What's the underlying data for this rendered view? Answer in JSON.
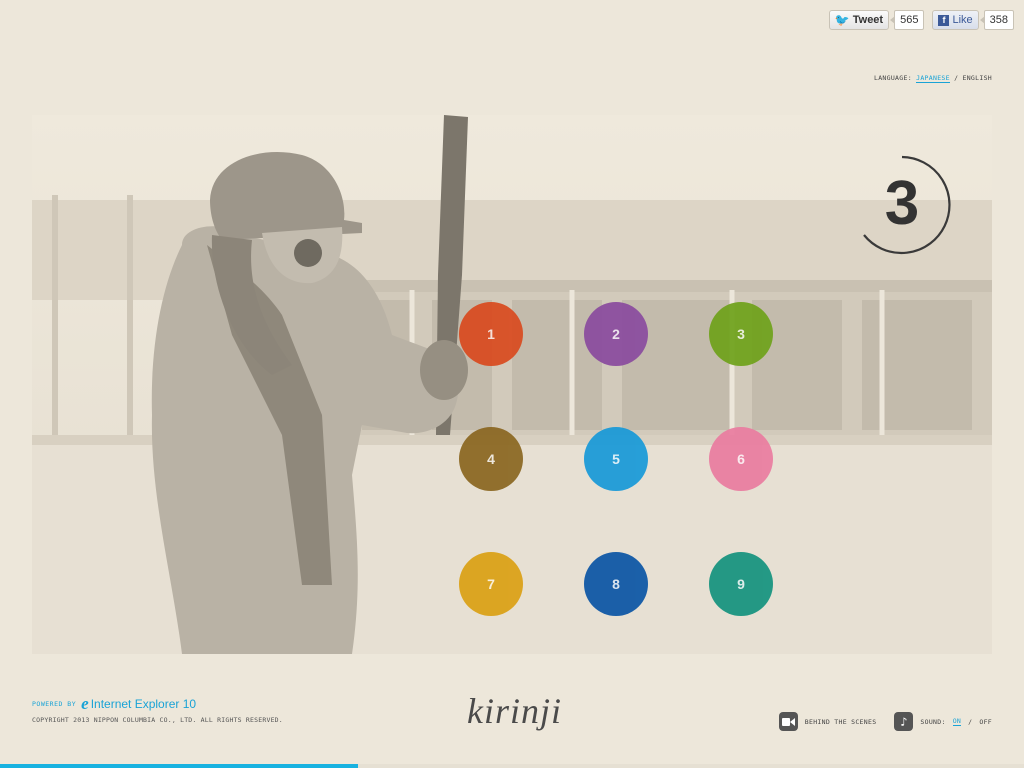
{
  "social": {
    "tweet_label": "Tweet",
    "tweet_count": "565",
    "like_label": "Like",
    "like_count": "358"
  },
  "language": {
    "label": "LANGUAGE:",
    "japanese": "JAPANESE",
    "separator": "/",
    "english": "ENGLISH",
    "active": "JAPANESE"
  },
  "counter": {
    "value": "3"
  },
  "dots": [
    {
      "label": "1",
      "color": "#d94a1e"
    },
    {
      "label": "2",
      "color": "#8a4b9e"
    },
    {
      "label": "3",
      "color": "#6fa21a"
    },
    {
      "label": "4",
      "color": "#8a6620"
    },
    {
      "label": "5",
      "color": "#1799d8"
    },
    {
      "label": "6",
      "color": "#ea7ca0"
    },
    {
      "label": "7",
      "color": "#dba014"
    },
    {
      "label": "8",
      "color": "#0a55a5"
    },
    {
      "label": "9",
      "color": "#14927e"
    }
  ],
  "footer": {
    "powered_by": "POWERED BY",
    "browser": "Internet Explorer 10",
    "copyright": "COPYRIGHT 2013 NIPPON COLUMBIA CO., LTD. ALL RIGHTS RESERVED.",
    "logo": "kirinji",
    "behind_scenes": "BEHIND THE SCENES",
    "sound_label": "SOUND:",
    "sound_on": "ON",
    "sound_sep": "/",
    "sound_off": "OFF"
  },
  "progress": {
    "fraction": 0.35
  },
  "colors": {
    "accent": "#19a3d6",
    "background": "#ede7da"
  }
}
